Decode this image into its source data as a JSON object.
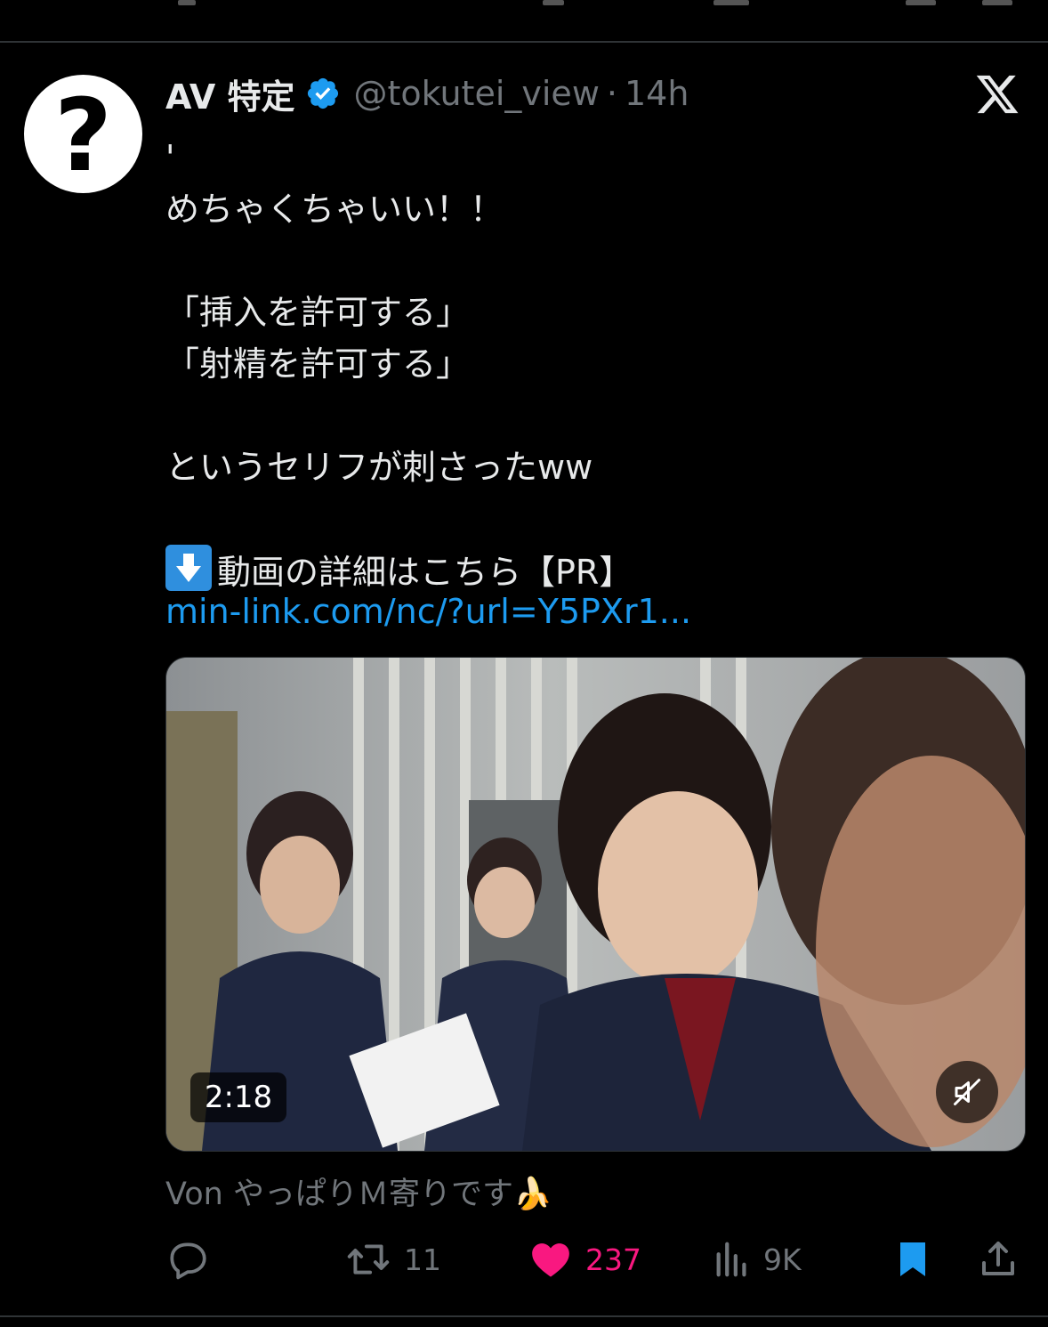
{
  "tweet": {
    "author": {
      "display_name": "AV 特定",
      "handle": "@tokutei_view",
      "separator": "·",
      "time": "14h",
      "avatar_glyph": "?",
      "verified_color": "#1d9bf0"
    },
    "text_lines": [
      "'",
      "めちゃくちゃいい！！",
      "",
      "「挿入を許可する」",
      "「射精を許可する」",
      "",
      "というセリフが刺さったww",
      "",
      "動画の詳細はこちら【PR】"
    ],
    "arrow_emoji": "down-arrow-emoji",
    "link": "min-link.com/nc/?url=Y5PXr1...",
    "media": {
      "duration": "2:18",
      "muted": true
    },
    "source": "Von やっぱりＭ寄りです🍌",
    "actions": {
      "retweets": "11",
      "likes": "237",
      "views": "9K",
      "liked": true,
      "bookmarked": true
    },
    "colors": {
      "link": "#1d9bf0",
      "like": "#f91880",
      "bookmark": "#1d9bf0",
      "muted_text": "#71767b"
    }
  }
}
